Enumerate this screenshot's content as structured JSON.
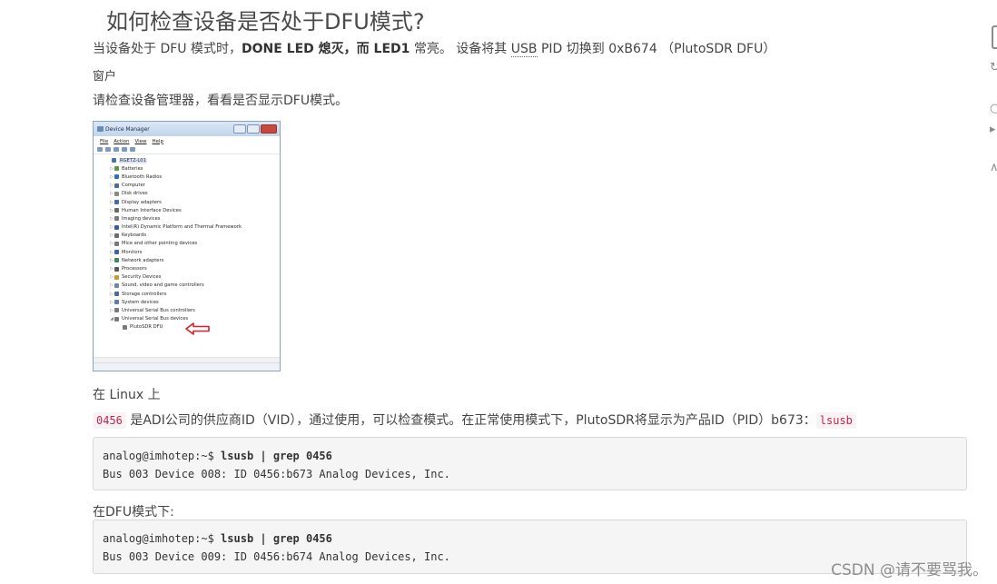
{
  "heading": "如何检查设备是否处于DFU模式?",
  "intro": {
    "prefix": "当设备处于 DFU 模式时，",
    "done_led": "DONE LED",
    "mid1": " 熄灭，而 ",
    "led1": "LED1",
    "mid2": " 常亮。 设备将其 ",
    "usb": "USB",
    "suffix": " PID 切换到 0xB674 （PlutoSDR DFU）"
  },
  "windows_label": "窗户",
  "windows_text": "请检查设备管理器，看看是否显示DFU模式。",
  "device_manager": {
    "title": "Device Manager",
    "menu": [
      "File",
      "Action",
      "View",
      "Help"
    ],
    "root": "RGETZ-L01",
    "items": [
      "Batteries",
      "Bluetooth Radios",
      "Computer",
      "Disk drives",
      "Display adapters",
      "Human Interface Devices",
      "Imaging devices",
      "Intel(R) Dynamic Platform and Thermal Framework",
      "Keyboards",
      "Mice and other pointing devices",
      "Monitors",
      "Network adapters",
      "Processors",
      "Security Devices",
      "Sound, video and game controllers",
      "Storage controllers",
      "System devices",
      "Universal Serial Bus controllers",
      "Universal Serial Bus devices"
    ],
    "leaf": "PlutoSDR DFU"
  },
  "linux_label": "在 Linux 上",
  "linux_text": {
    "code1": "0456",
    "middle": " 是ADI公司的供应商ID（VID），通过使用，可以检查模式。在正常使用模式下，PlutoSDR将显示为产品ID（PID）b673：",
    "code2": "lsusb"
  },
  "code_normal": {
    "prompt": "analog@imhotep:~$ ",
    "command": "lsusb | grep 0456",
    "output": "Bus 003 Device 008: ID 0456:b673 Analog Devices, Inc."
  },
  "dfu_label": "在DFU模式下:",
  "code_dfu": {
    "prompt": "analog@imhotep:~$ ",
    "command": "lsusb | grep 0456",
    "output": "Bus 003 Device 009: ID 0456:b674 Analog Devices, Inc."
  },
  "watermark": "CSDN @请不要骂我。"
}
